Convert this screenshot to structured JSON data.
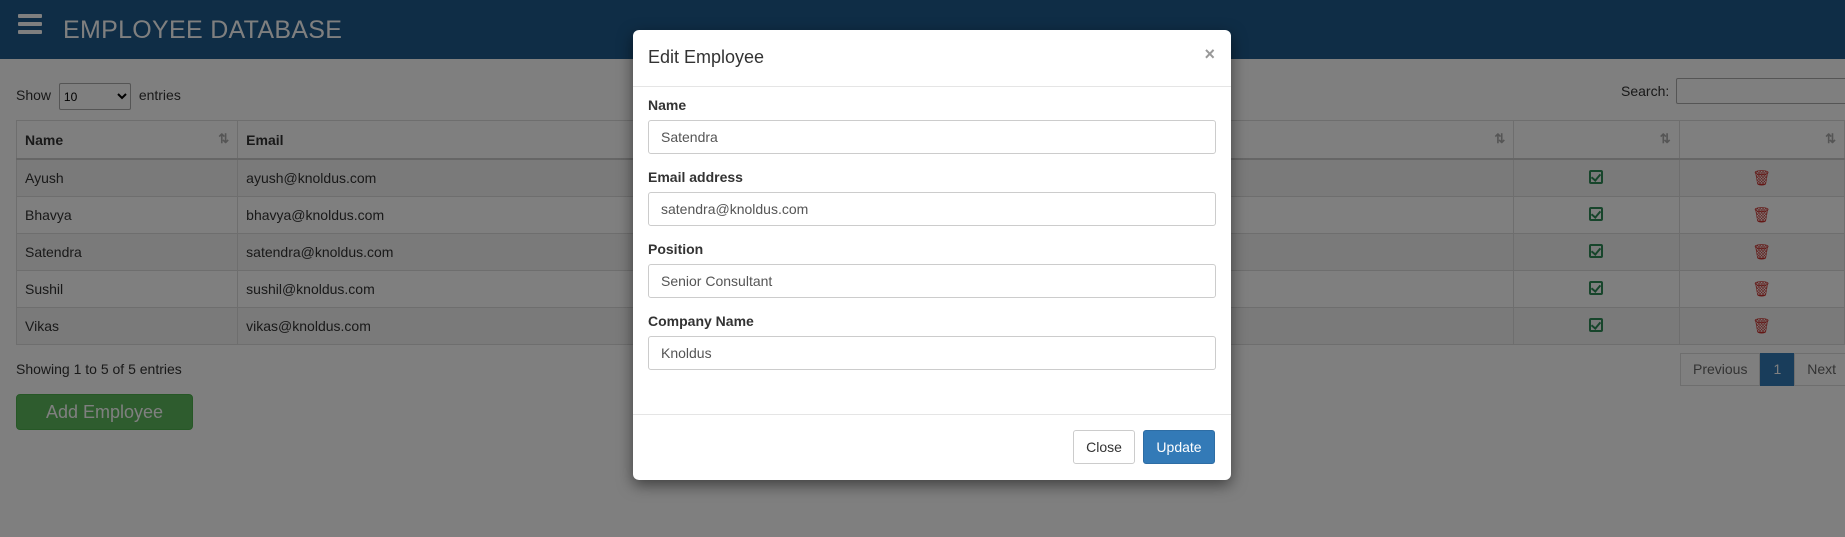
{
  "app": {
    "title": "EMPLOYEE DATABASE"
  },
  "controls": {
    "show_label": "Show",
    "entries_label": "entries",
    "page_length": "10",
    "search_label": "Search:",
    "search_value": ""
  },
  "table": {
    "columns": [
      "Name",
      "Email"
    ],
    "rows": [
      {
        "name": "Ayush",
        "email": "ayush@knoldus.com"
      },
      {
        "name": "Bhavya",
        "email": "bhavya@knoldus.com"
      },
      {
        "name": "Satendra",
        "email": "satendra@knoldus.com"
      },
      {
        "name": "Sushil",
        "email": "sushil@knoldus.com"
      },
      {
        "name": "Vikas",
        "email": "vikas@knoldus.com"
      }
    ],
    "edit_icon": "edit-icon",
    "delete_icon": "trash-icon"
  },
  "info": "Showing 1 to 5 of 5 entries",
  "pagination": {
    "previous": "Previous",
    "current": "1",
    "next": "Next"
  },
  "add_button": "Add Employee",
  "modal": {
    "title": "Edit Employee",
    "close_symbol": "×",
    "fields": [
      {
        "label": "Name",
        "value": "Satendra"
      },
      {
        "label": "Email address",
        "value": "satendra@knoldus.com"
      },
      {
        "label": "Position",
        "value": "Senior Consultant"
      },
      {
        "label": "Company Name",
        "value": "Knoldus"
      }
    ],
    "close_button": "Close",
    "update_button": "Update"
  },
  "colors": {
    "navbar": "#1e5a8c",
    "primary": "#337ab7",
    "success": "#5cb85c",
    "edit_icon": "#2e8b57",
    "delete_icon": "#c9302c"
  }
}
